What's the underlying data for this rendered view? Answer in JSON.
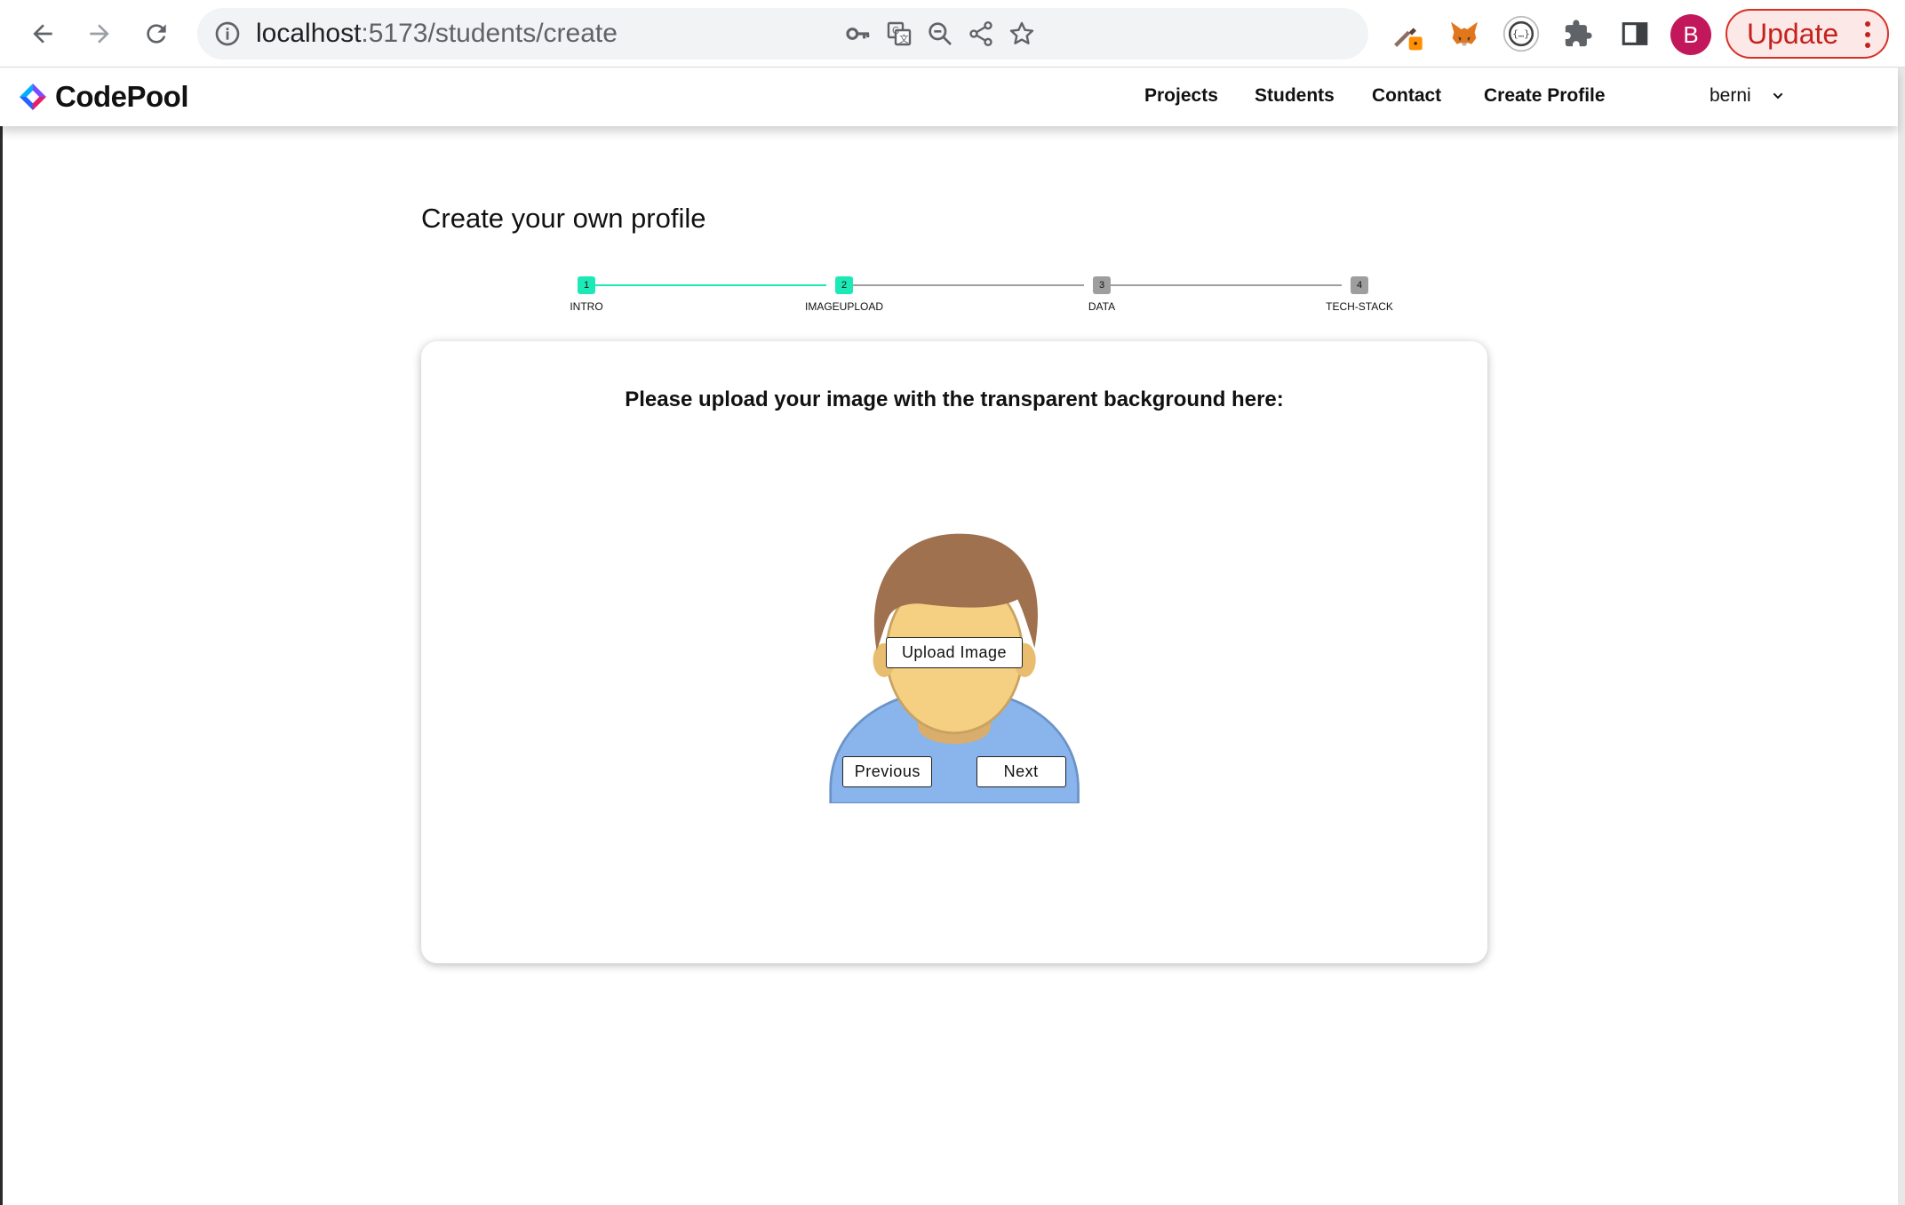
{
  "browser": {
    "url_host": "localhost",
    "url_path": ":5173/students/create",
    "profile_initial": "B",
    "update_label": "Update"
  },
  "header": {
    "brand": "CodePool",
    "nav": [
      "Projects",
      "Students",
      "Contact",
      "Create Profile"
    ],
    "user": "berni"
  },
  "page": {
    "title": "Create your own profile"
  },
  "stepper": {
    "steps": [
      {
        "number": "1",
        "label": "INTRO",
        "done": true
      },
      {
        "number": "2",
        "label": "IMAGEUPLOAD",
        "done": true
      },
      {
        "number": "3",
        "label": "DATA",
        "done": false
      },
      {
        "number": "4",
        "label": "TECH-STACK",
        "done": false
      }
    ],
    "active_color": "#1de9b6",
    "inactive_color": "#9e9e9e"
  },
  "card": {
    "heading": "Please upload your image with the transparent background here:",
    "upload_label": "Upload Image",
    "previous_label": "Previous",
    "next_label": "Next"
  },
  "colors": {
    "accent": "#1de9b6",
    "update_red": "#c5221f",
    "avatar_bg": "#c2185b"
  }
}
